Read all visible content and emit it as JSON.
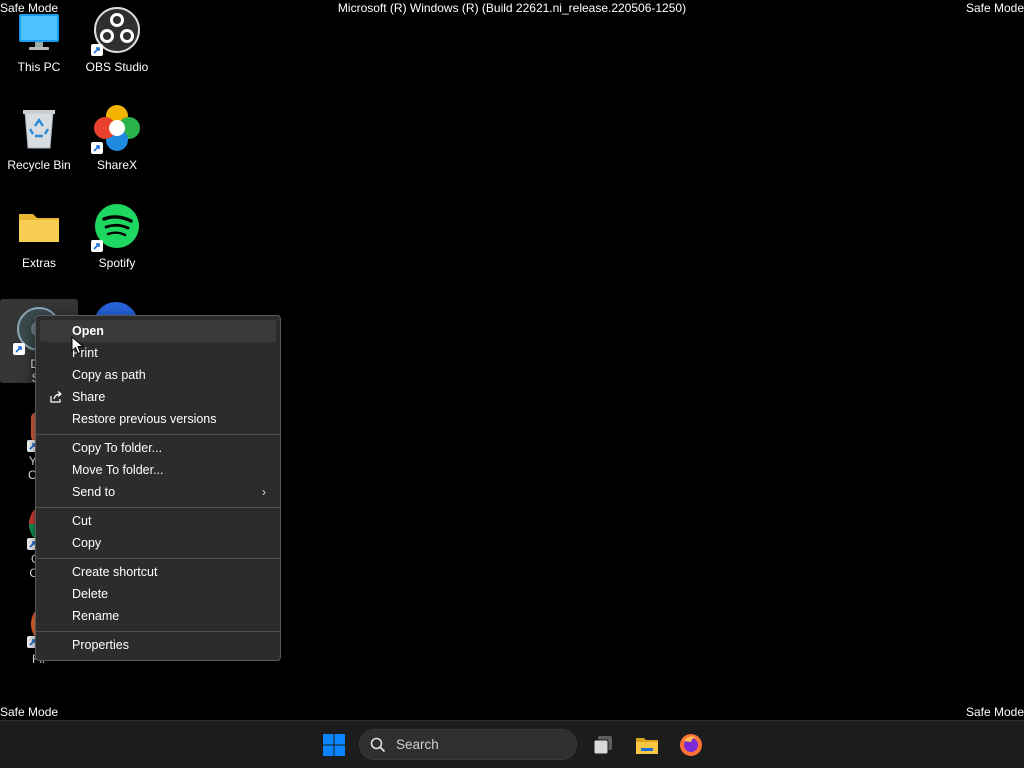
{
  "banner": {
    "safe_mode": "Safe Mode",
    "build": "Microsoft (R) Windows (R) (Build 22621.ni_release.220506-1250)"
  },
  "desktop_icons": {
    "this_pc": "This PC",
    "obs": "OBS Studio",
    "recycle_bin": "Recycle Bin",
    "sharex": "ShareX",
    "extras": "Extras",
    "spotify": "Spotify",
    "disk_partial_1": "Dis",
    "disk_partial_2": "Se",
    "you_partial_1": "You",
    "you_partial_2": "Cha",
    "chrome_partial_1": "Go",
    "chrome_partial_2": "Chr",
    "firefox_partial": "Fir"
  },
  "context_menu": {
    "open": "Open",
    "print": "Print",
    "copy_as_path": "Copy as path",
    "share": "Share",
    "restore": "Restore previous versions",
    "copy_to_folder": "Copy To folder...",
    "move_to_folder": "Move To folder...",
    "send_to": "Send to",
    "cut": "Cut",
    "copy": "Copy",
    "create_shortcut": "Create shortcut",
    "delete": "Delete",
    "rename": "Rename",
    "properties": "Properties"
  },
  "taskbar": {
    "search_placeholder": "Search"
  },
  "colors": {
    "desktop_bg": "#000000",
    "menu_bg": "#2c2c2c",
    "taskbar_bg": "#1c1c1c",
    "win_blue": "#0a84ff",
    "spotify_green": "#1ed760"
  }
}
